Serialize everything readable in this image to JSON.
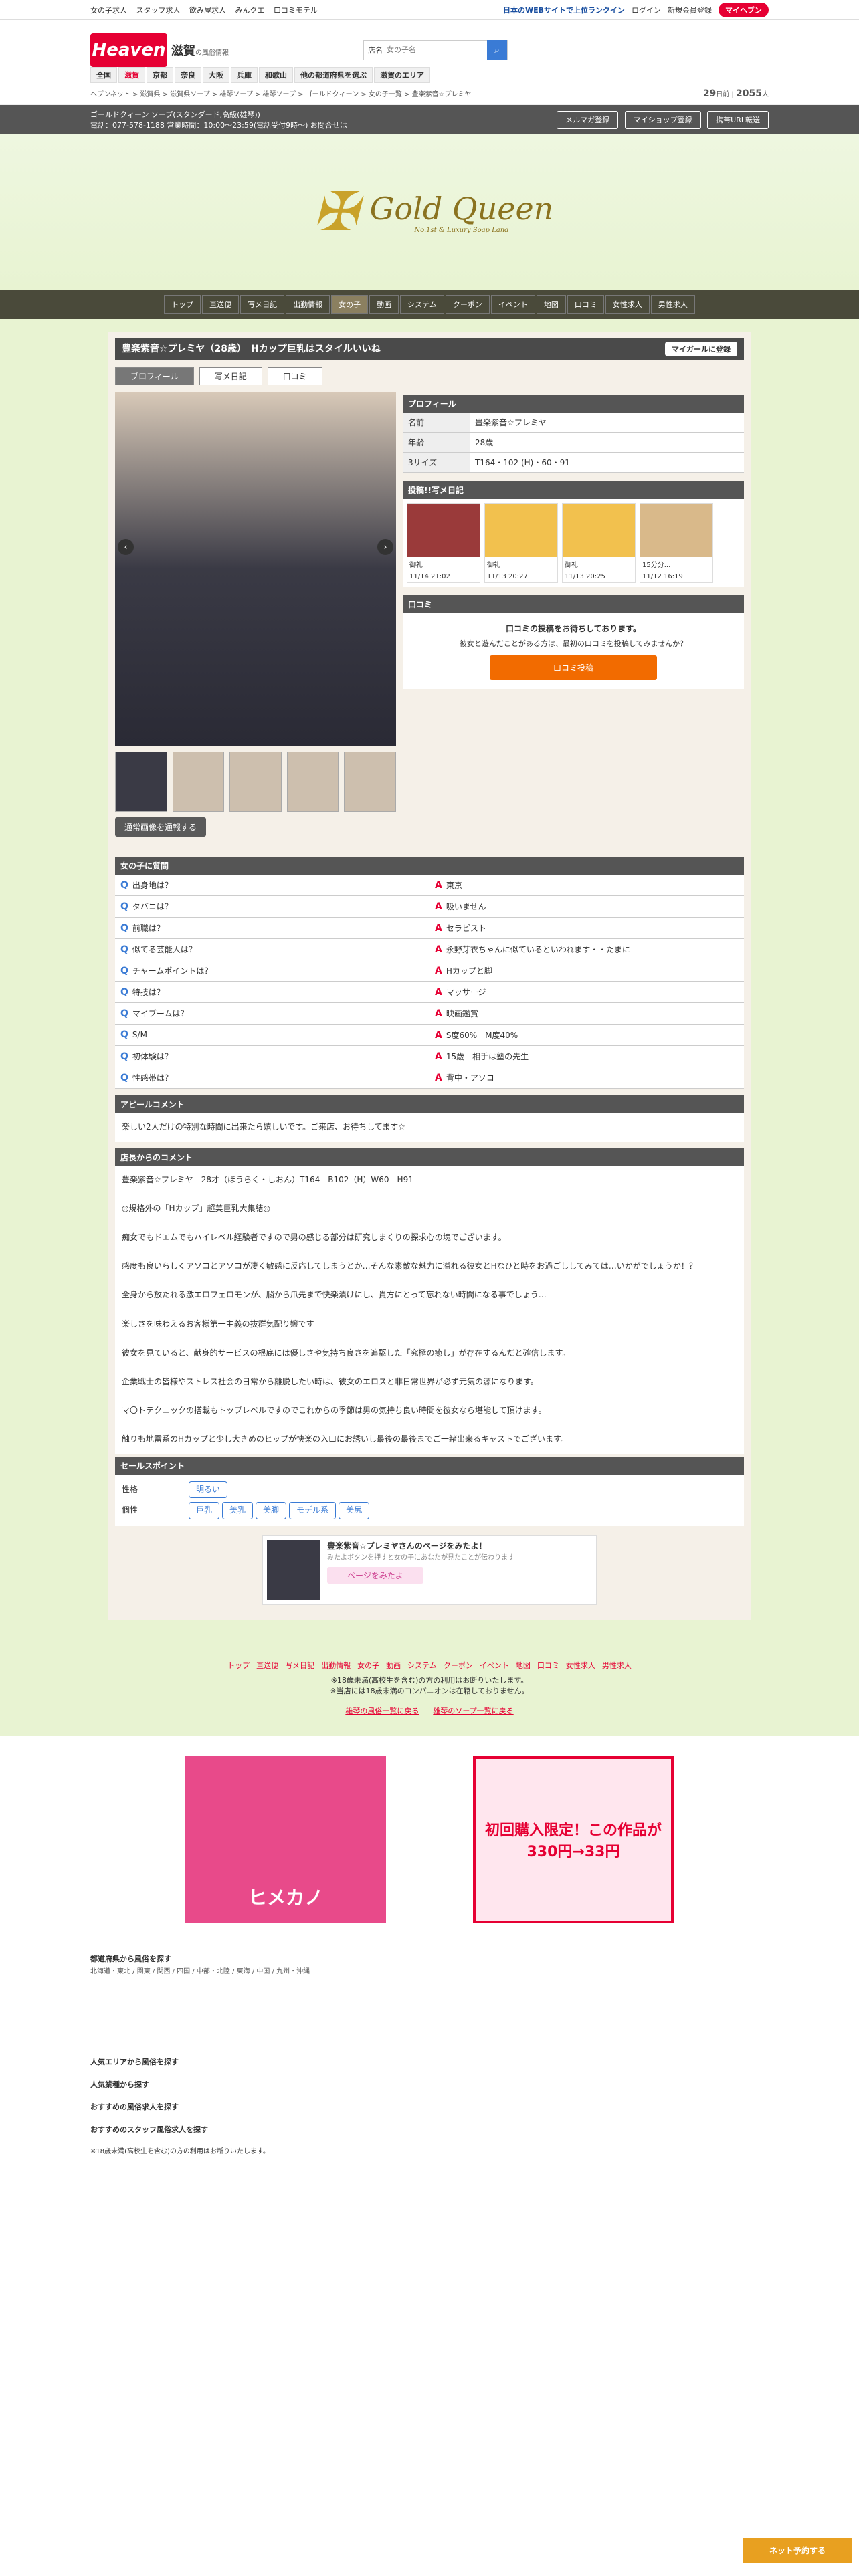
{
  "topbar": {
    "links": [
      "女の子求人",
      "スタッフ求人",
      "飲み屋求人",
      "みんクエ",
      "口コミモテル"
    ],
    "rank": "日本のWEBサイトで上位ランクイン",
    "login": "ログイン",
    "register": "新規会員登録",
    "mypage": "マイヘブン"
  },
  "header": {
    "logo": "Heaven",
    "region": "滋賀",
    "region_sub": "の風俗情報",
    "search_label": "店名",
    "search_placeholder": "女の子名"
  },
  "nav": [
    "全国",
    "滋賀",
    "京都",
    "奈良",
    "大阪",
    "兵庫",
    "和歌山",
    "他の都道府県を選ぶ",
    "滋賀のエリア"
  ],
  "breadcrumb": "ヘブンネット > 滋賀県 > 滋賀県ソープ > 雄琴ソープ > 雄琴ソープ > ゴールドクィーン > 女の子一覧 > 豊楽紫音☆プレミヤ",
  "counts": {
    "a": "29",
    "a_label": "日前",
    "b": "2055",
    "b_label": "人"
  },
  "shop": {
    "line1": "ゴールドクィーン ソープ(スタンダード,高級(雄琴))",
    "line2": "電話：077-578-1188 営業時間：10:00〜23:59(電話受付9時〜) お問合せは",
    "btns": [
      "メルマガ登録",
      "マイショップ登録",
      "携帯URL転送"
    ]
  },
  "hero": {
    "brand": "Gold Queen",
    "sub": "No.1st & Luxury Soap Land"
  },
  "shopnav": [
    "トップ",
    "直送便",
    "写メ日記",
    "出勤情報",
    "女の子",
    "動画",
    "システム",
    "クーポン",
    "イベント",
    "地図",
    "口コミ",
    "女性求人",
    "男性求人"
  ],
  "girl": {
    "title": "豊楽紫音☆プレミヤ（28歳）",
    "catch": "Hカップ巨乳はスタイルいいね",
    "fav": "マイガールに登録"
  },
  "tabs": [
    "プロフィール",
    "写メ日記",
    "口コミ"
  ],
  "profile": {
    "head": "プロフィール",
    "rows": [
      [
        "名前",
        "豊楽紫音☆プレミヤ"
      ],
      [
        "年齢",
        "28歳"
      ],
      [
        "3サイズ",
        "T164・102 (H)・60・91"
      ]
    ]
  },
  "diary": {
    "head": "投稿!!写メ日記",
    "cards": [
      {
        "t": "御礼",
        "d": "11/14 21:02"
      },
      {
        "t": "御礼",
        "d": "11/13 20:27"
      },
      {
        "t": "御礼",
        "d": "11/13 20:25"
      },
      {
        "t": "15分分...",
        "d": "11/12 16:19"
      }
    ]
  },
  "review": {
    "head": "口コミ",
    "msg": "口コミの投稿をお待ちしております。",
    "sub": "彼女と遊んだことがある方は、最初の口コミを投稿してみませんか？",
    "btn": "口コミ投稿"
  },
  "photo_btn": "通常画像を通報する",
  "qa": {
    "head": "女の子に質問",
    "rows": [
      [
        "出身地は？",
        "東京"
      ],
      [
        "タバコは？",
        "吸いません"
      ],
      [
        "前職は？",
        "セラピスト"
      ],
      [
        "似てる芸能人は？",
        "永野芽衣ちゃんに似ているといわれます・・たまに"
      ],
      [
        "チャームポイントは？",
        "Hカップと脚"
      ],
      [
        "特技は？",
        "マッサージ"
      ],
      [
        "マイブームは？",
        "映画鑑賞"
      ],
      [
        "S/M",
        "S度60%　M度40%"
      ],
      [
        "初体験は？",
        "15歳　相手は塾の先生"
      ],
      [
        "性感帯は？",
        "背中・アソコ"
      ]
    ]
  },
  "appeal": {
    "head": "アピールコメント",
    "text": "楽しい2人だけの特別な時間に出来たら嬉しいです。ご来店、お待ちしてます☆"
  },
  "shopcomment": {
    "head": "店長からのコメント",
    "paras": [
      "豊楽紫音☆プレミヤ　28才（ほうらく・しおん）T164　B102（H）W60　H91",
      "◎規格外の「Hカップ」超美巨乳大集結◎",
      "痴女でもドエムでもハイレベル経験者ですので男の感じる部分は研究しまくりの探求心の塊でございます。",
      "感度も良いらしくアソコとアソコが凄く敏感に反応してしまうとか…そんな素敵な魅力に溢れる彼女とHなひと時をお過ごししてみては…いかがでしょうか！？",
      "全身から放たれる激エロフェロモンが、脳から爪先まで快楽漬けにし、貴方にとって忘れない時間になる事でしょう…",
      "楽しさを味わえるお客様第一主義の抜群気配り嬢です",
      "彼女を見ていると、献身的サービスの根底には優しさや気持ち良さを追駆した「究極の癒し」が存在するんだと確信します。",
      "企業戦士の皆様やストレス社会の日常から離脱したい時は、彼女のエロスと非日常世界が必ず元気の源になります。",
      "マ〇トテクニックの搭載もトップレベルですのでこれからの季節は男の気持ち良い時間を彼女なら堪能して頂けます。",
      "触りも地雷系のHカップと少し大きめのヒップが快楽の入口にお誘いし最後の最後までご一緒出来るキャストでございます。"
    ]
  },
  "sales": {
    "head": "セールスポイント",
    "seikaku_label": "性格",
    "seikaku": [
      "明るい"
    ],
    "kosei_label": "個性",
    "kosei": [
      "巨乳",
      "美乳",
      "美脚",
      "モデル系",
      "美尻"
    ]
  },
  "promo": {
    "text": "豊楽紫音☆プレミヤさんのページをみたよ！",
    "sub": "みたよボタンを押すと女の子にあなたが見たことが伝わります",
    "btn": "ページをみたよ"
  },
  "bottomnav": [
    "トップ",
    "直送便",
    "写メ日記",
    "出勤情報",
    "女の子",
    "動画",
    "システム",
    "クーポン",
    "イベント",
    "地図",
    "口コミ",
    "女性求人",
    "男性求人"
  ],
  "notice": [
    "※18歳未満(高校生を含む)の方の利用はお断りいたします。",
    "※当店には18歳未満のコンパニオンは在籍しておりません。"
  ],
  "backlinks": [
    "雄琴の風俗一覧に戻る",
    "雄琴のソープ一覧に戻る"
  ],
  "banners": [
    {
      "t": "ヒメカノ",
      "c": "#e84a8a"
    },
    {
      "t": "初回購入限定！この作品が330円→33円",
      "c": "#ffe6ee"
    }
  ],
  "footer": {
    "h1": "都道府県から風俗を探す",
    "h2": "人気エリアから風俗を探す",
    "h3": "人気業種から探す",
    "h4": "おすすめの風俗求人を探す",
    "h5": "おすすめのスタッフ風俗求人を探す",
    "note": "※18歳未満(高校生を含む)の方の利用はお断りいたします。"
  },
  "reserve": "ネット予約する"
}
